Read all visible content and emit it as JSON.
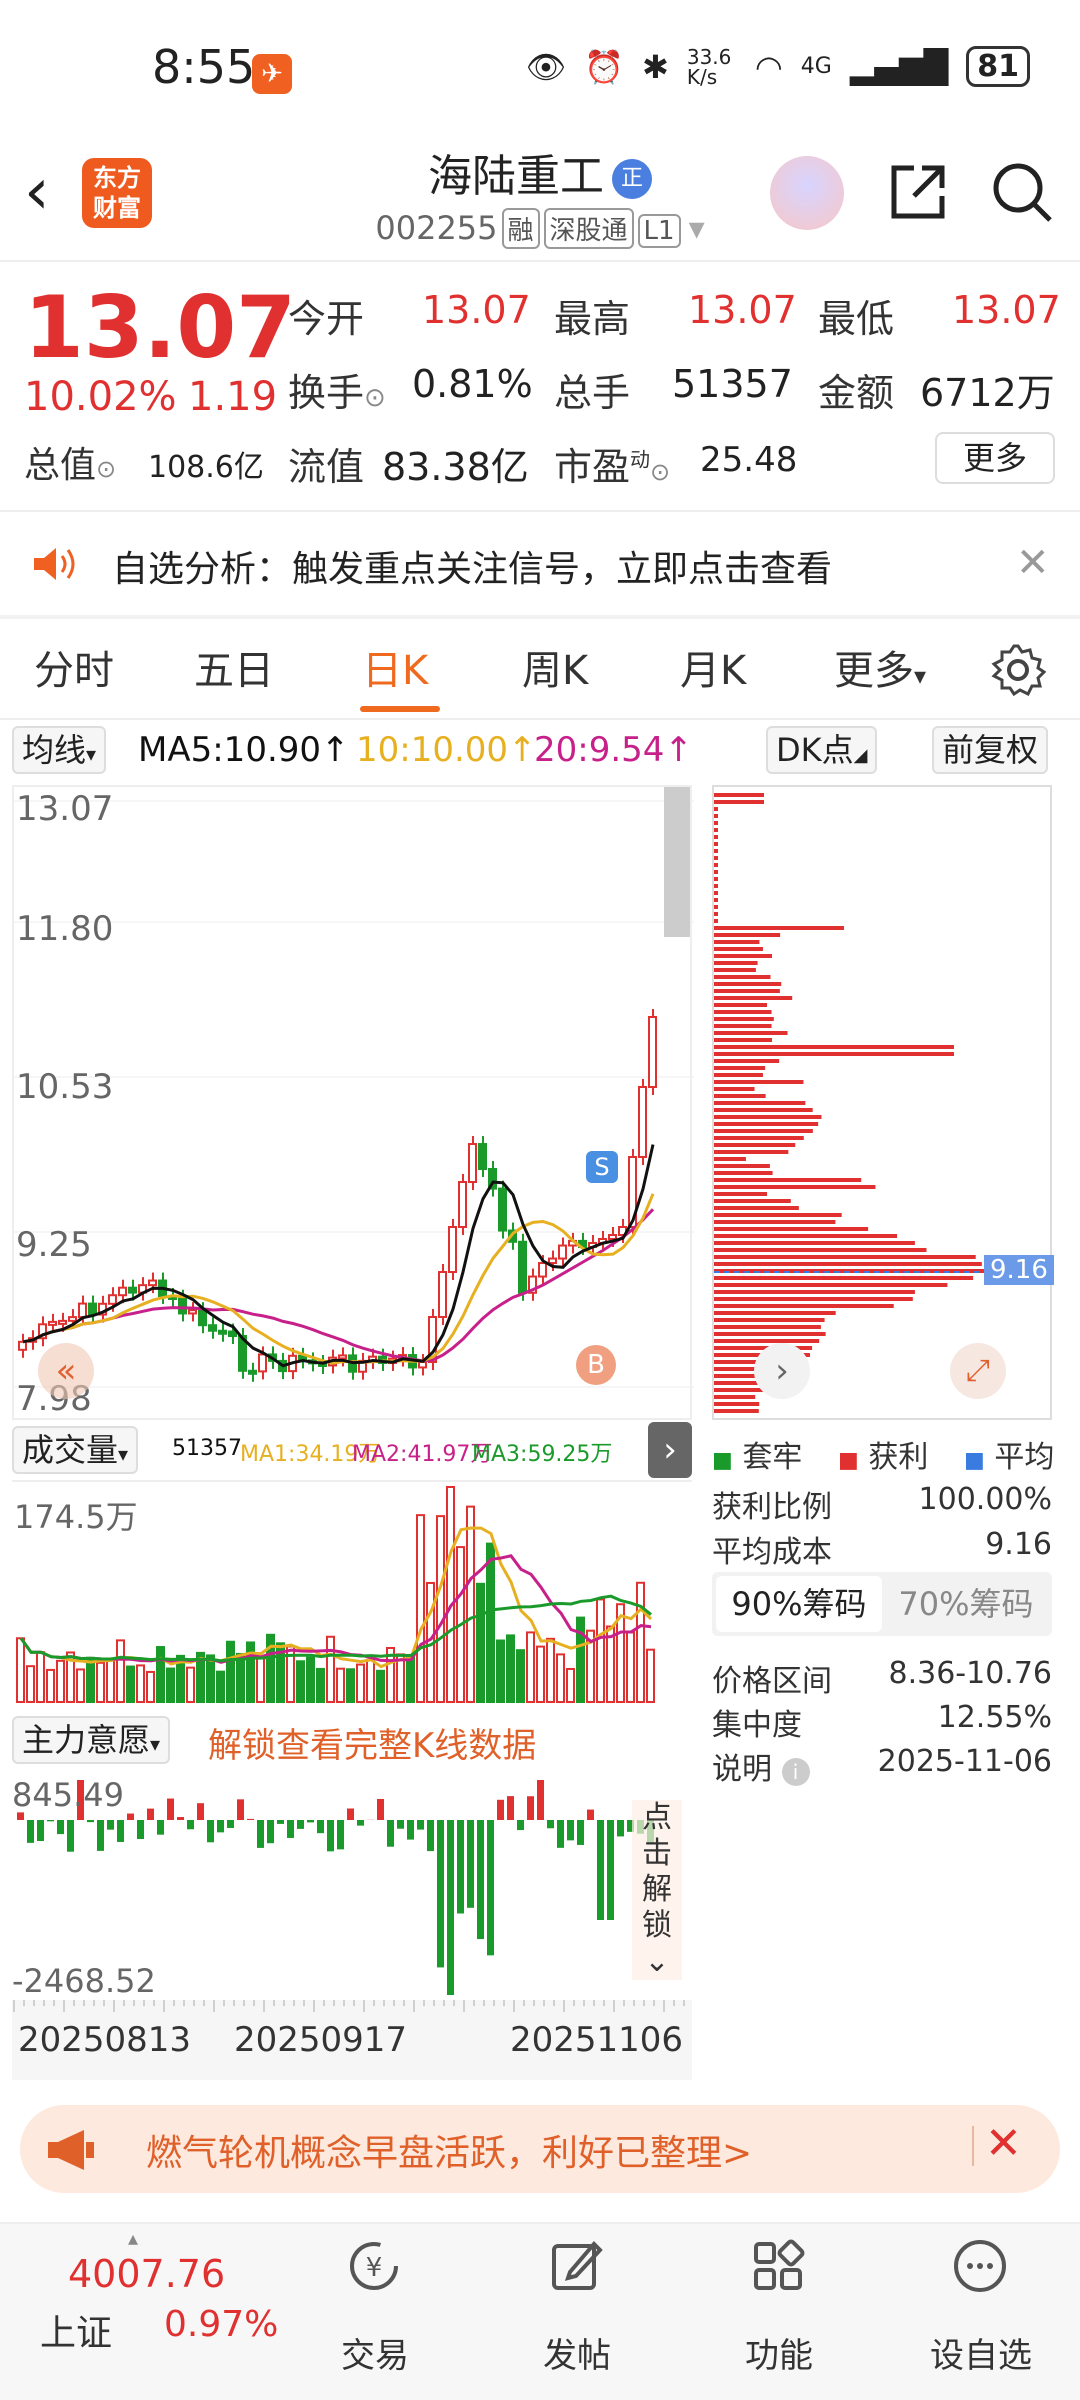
{
  "status_bar": {
    "time": "8:55",
    "net_speed": "33.6 K/s",
    "network": "4G",
    "battery": "81"
  },
  "header": {
    "logo_text": "东方财富",
    "stock_name": "海陆重工",
    "badge": "正",
    "code": "002255",
    "tags": [
      "融",
      "深股通",
      "L1"
    ]
  },
  "quote": {
    "price": "13.07",
    "change_pct": "10.02%",
    "change_amt": "1.19",
    "fields": [
      {
        "label": "今开",
        "value": "13.07"
      },
      {
        "label": "最高",
        "value": "13.07"
      },
      {
        "label": "最低",
        "value": "13.07"
      },
      {
        "label": "换手",
        "value": "0.81%"
      },
      {
        "label": "总手",
        "value": "51357"
      },
      {
        "label": "金额",
        "value": "6712万"
      },
      {
        "label": "总值",
        "value": "108.6亿"
      },
      {
        "label": "流值",
        "value": "83.38亿"
      },
      {
        "label": "市盈",
        "value": "25.48",
        "sup": "动"
      }
    ],
    "more_label": "更多"
  },
  "alert": {
    "text": "自选分析：触发重点关注信号，立即点击查看"
  },
  "tabs": [
    "分时",
    "五日",
    "日K",
    "周K",
    "月K",
    "更多"
  ],
  "active_tab": 2,
  "ma_row": {
    "selector": "均线",
    "ma5": "MA5:10.90↑",
    "ma10": "10:10.00↑",
    "ma20": "20:9.54↑",
    "dk_label": "DK点",
    "adjust_label": "前复权"
  },
  "kchart": {
    "y_labels": [
      "13.07",
      "11.80",
      "10.53",
      "9.25",
      "7.98"
    ],
    "signal_s": "S",
    "signal_b": "B",
    "profile_avg": "9.16"
  },
  "volume": {
    "selector": "成交量",
    "current": "51357",
    "ma1": "MA1:34.19万",
    "ma2": "MA2:41.97万",
    "ma3": "MA3:59.25万",
    "max_label": "174.5万"
  },
  "zhuli": {
    "selector": "主力意愿",
    "unlock_text": "解锁查看完整K线数据",
    "max_label": "845.49",
    "min_label": "-2468.52",
    "unlock_btn": "点击解锁"
  },
  "dates": [
    "20250813",
    "20250917",
    "20251106"
  ],
  "cost_panel": {
    "legend": [
      {
        "label": "套牢",
        "color": "#1a9a2a"
      },
      {
        "label": "获利",
        "color": "#e03030"
      },
      {
        "label": "平均",
        "color": "#3a7be0"
      }
    ],
    "rows": [
      {
        "label": "获利比例",
        "value": "100.00%"
      },
      {
        "label": "平均成本",
        "value": "9.16"
      }
    ],
    "tabs": [
      "90%筹码",
      "70%筹码"
    ],
    "rows2": [
      {
        "label": "价格区间",
        "value": "8.36-10.76"
      },
      {
        "label": "集中度",
        "value": "12.55%"
      },
      {
        "label": "说明",
        "value": "2025-11-06"
      }
    ]
  },
  "banner": {
    "text": "燃气轮机概念早盘活跃，利好已整理>"
  },
  "bottom_nav": {
    "index_value": "4007.76",
    "index_name": "上证",
    "index_pct": "0.97%",
    "items": [
      "交易",
      "发帖",
      "功能",
      "设自选"
    ]
  },
  "colors": {
    "up": "#e03030",
    "down": "#1a9a2a",
    "accent": "#ef6a1e",
    "ma5": "#111111",
    "ma10": "#e6b020",
    "ma20": "#c8208a"
  }
}
